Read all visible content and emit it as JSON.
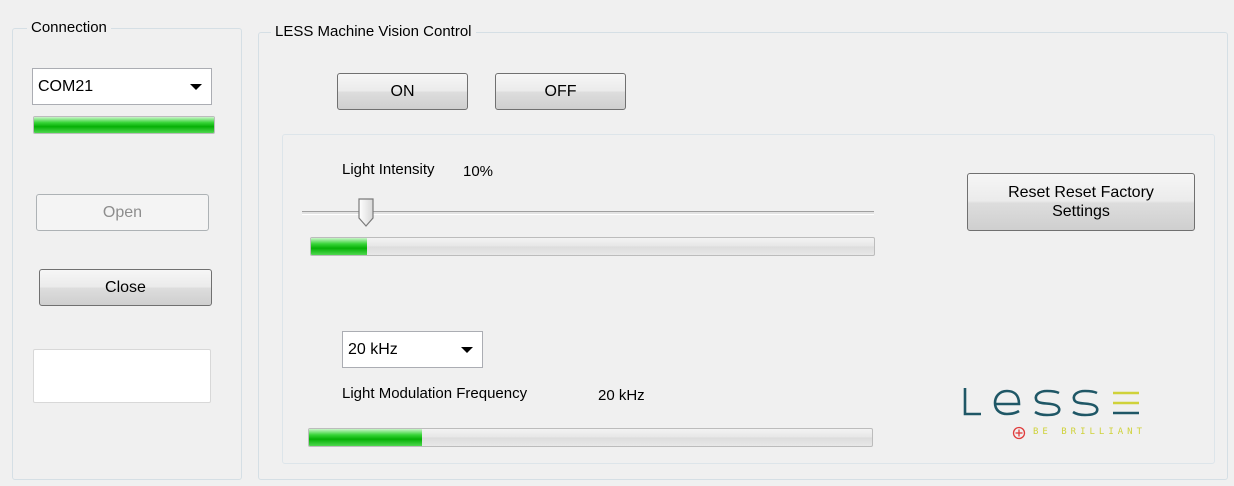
{
  "connection": {
    "title": "Connection",
    "port_selected": "COM21",
    "status_level": 1.0,
    "open_label": "Open",
    "close_label": "Close",
    "status_text": ""
  },
  "control": {
    "title": "LESS Machine Vision Control",
    "on_label": "ON",
    "off_label": "OFF",
    "intensity_label": "Light Intensity",
    "intensity_value": "10%",
    "intensity_level": 0.1,
    "reset_label": "Reset  Reset Factory Settings",
    "frequency_selected": "20 kHz",
    "frequency_label": "Light Modulation Frequency",
    "frequency_value": "20 kHz",
    "frequency_level": 0.2
  },
  "logo": {
    "wordmark": "LESS",
    "tagline": "BE BRILLIANT"
  },
  "colors": {
    "progress_green": "#06b006",
    "logo_teal": "#1f5766",
    "logo_yellow": "#cfd23a",
    "logo_red": "#e03b3b"
  }
}
